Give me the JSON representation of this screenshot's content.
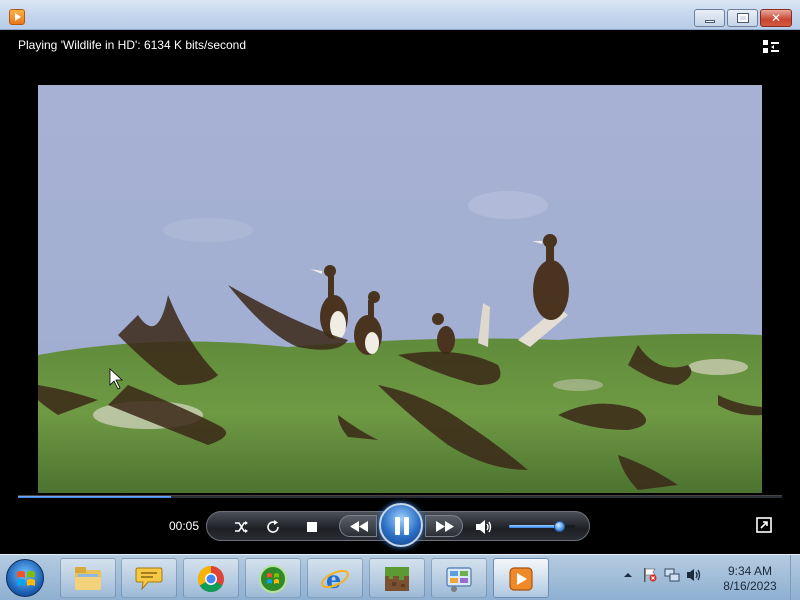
{
  "window": {
    "buttons": {
      "minimize": "",
      "maximize": "",
      "close": "✕"
    }
  },
  "player": {
    "status_text": "Playing 'Wildlife in HD': 6134 K bits/second",
    "elapsed_time": "00:05",
    "seek_progress": 0.2,
    "volume_level": 0.78,
    "controls": [
      "shuffle-icon",
      "repeat-icon",
      "stop-icon",
      "previous-icon",
      "pause-icon",
      "next-icon",
      "volume-icon"
    ]
  },
  "taskbar": {
    "apps": [
      "folder-icon",
      "chat-bubble-icon",
      "chrome-icon",
      "windows-media-center-icon",
      "internet-explorer-icon",
      "minecraft-icon",
      "control-panel-icon",
      "media-player-icon"
    ],
    "clock": {
      "time": "9:34 AM",
      "date": "8/16/2023"
    },
    "tray_icons": [
      "show-hidden-icons",
      "action-center-flag-icon",
      "network-icon",
      "volume-icon"
    ]
  },
  "colors": {
    "accent": "#2e74d8",
    "titlebar": "#c3d5ec",
    "close": "#c84630"
  }
}
